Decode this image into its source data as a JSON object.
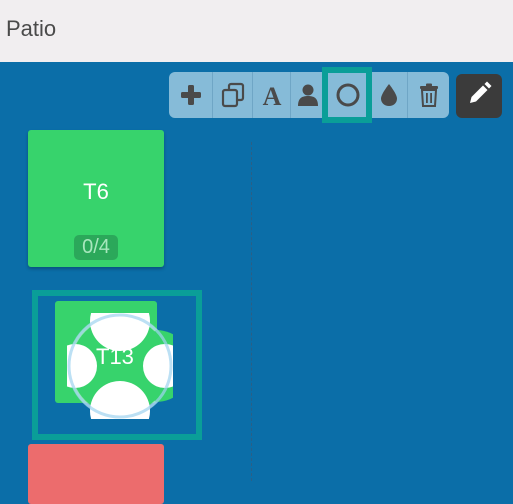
{
  "header": {
    "title": "Patio"
  },
  "toolbar": {
    "tools": [
      {
        "name": "add",
        "icon": "plus-icon"
      },
      {
        "name": "duplicate",
        "icon": "copy-icon"
      },
      {
        "name": "text",
        "icon": "font-icon"
      },
      {
        "name": "person",
        "icon": "user-icon"
      },
      {
        "name": "circle",
        "icon": "circle-icon",
        "selected": true
      },
      {
        "name": "color",
        "icon": "droplet-icon"
      },
      {
        "name": "delete",
        "icon": "trash-icon"
      }
    ],
    "edit_icon": "pencil-icon"
  },
  "tables": [
    {
      "name": "T6",
      "count": "0/4",
      "color": "#37d36c"
    },
    {
      "name": "T13",
      "color": "#37d36c",
      "selected": true
    },
    {
      "name": "",
      "color": "#ec6c6d"
    }
  ],
  "colors": {
    "canvas": "#0b6ea8",
    "header": "#f1eef0",
    "toolbar": "#86bbd8",
    "selection": "#0a9e98"
  }
}
